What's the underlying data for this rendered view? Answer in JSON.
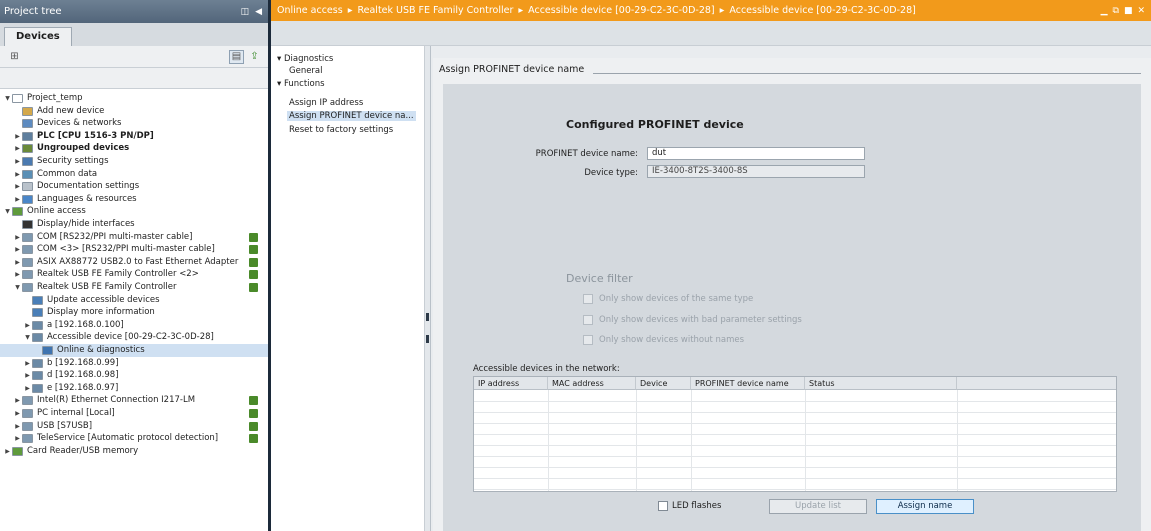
{
  "project_tree": {
    "title": "Project tree",
    "tab": "Devices",
    "items": [
      {
        "label": "Project_temp",
        "level": 0,
        "toggle": "▼",
        "icon": "#ffffff",
        "bold": false
      },
      {
        "label": "Add new device",
        "level": 1,
        "toggle": "",
        "icon": "#d4a84a",
        "bold": false
      },
      {
        "label": "Devices & networks",
        "level": 1,
        "toggle": "",
        "icon": "#5d8bc0",
        "bold": false
      },
      {
        "label": "PLC [CPU 1516-3 PN/DP]",
        "level": 1,
        "toggle": "▶",
        "icon": "#5f7f9e",
        "bold": true
      },
      {
        "label": "Ungrouped devices",
        "level": 1,
        "toggle": "▶",
        "icon": "#6a8a3a",
        "bold": true
      },
      {
        "label": "Security settings",
        "level": 1,
        "toggle": "▶",
        "icon": "#4b7ab0",
        "bold": false
      },
      {
        "label": "Common data",
        "level": 1,
        "toggle": "▶",
        "icon": "#5a8fb5",
        "bold": false
      },
      {
        "label": "Documentation settings",
        "level": 1,
        "toggle": "▶",
        "icon": "#b9c2cb",
        "bold": false
      },
      {
        "label": "Languages & resources",
        "level": 1,
        "toggle": "▶",
        "icon": "#4a86c8",
        "bold": false
      },
      {
        "label": "Online access",
        "level": 0,
        "toggle": "▼",
        "icon": "#5f9b3c",
        "bold": false
      },
      {
        "label": "Display/hide interfaces",
        "level": 1,
        "toggle": "",
        "icon": "#333333",
        "bold": false
      },
      {
        "label": "COM [RS232/PPI multi-master cable]",
        "level": 1,
        "toggle": "▶",
        "icon": "#7f99b0",
        "bold": false,
        "badge": true
      },
      {
        "label": "COM <3> [RS232/PPI multi-master cable]",
        "level": 1,
        "toggle": "▶",
        "icon": "#7f99b0",
        "bold": false,
        "badge": true
      },
      {
        "label": "ASIX AX88772 USB2.0 to Fast Ethernet Adapter",
        "level": 1,
        "toggle": "▶",
        "icon": "#7f99b0",
        "bold": false,
        "badge": true
      },
      {
        "label": "Realtek USB FE Family Controller <2>",
        "level": 1,
        "toggle": "▶",
        "icon": "#7f99b0",
        "bold": false,
        "badge": true
      },
      {
        "label": "Realtek USB FE Family Controller",
        "level": 1,
        "toggle": "▼",
        "icon": "#7f99b0",
        "bold": false,
        "badge": true
      },
      {
        "label": "Update accessible devices",
        "level": 2,
        "toggle": "",
        "icon": "#4a7fb8",
        "bold": false
      },
      {
        "label": "Display more information",
        "level": 2,
        "toggle": "",
        "icon": "#4a7fb8",
        "bold": false
      },
      {
        "label": "a [192.168.0.100]",
        "level": 2,
        "toggle": "▶",
        "icon": "#6b8aa6",
        "bold": false
      },
      {
        "label": "Accessible device [00-29-C2-3C-0D-28]",
        "level": 2,
        "toggle": "▼",
        "icon": "#6b8aa6",
        "bold": false
      },
      {
        "label": "Online & diagnostics",
        "level": 3,
        "toggle": "",
        "icon": "#3f74b0",
        "bold": false,
        "selected": true
      },
      {
        "label": "b [192.168.0.99]",
        "level": 2,
        "toggle": "▶",
        "icon": "#6b8aa6",
        "bold": false
      },
      {
        "label": "d [192.168.0.98]",
        "level": 2,
        "toggle": "▶",
        "icon": "#6b8aa6",
        "bold": false
      },
      {
        "label": "e [192.168.0.97]",
        "level": 2,
        "toggle": "▶",
        "icon": "#6b8aa6",
        "bold": false
      },
      {
        "label": "Intel(R) Ethernet Connection I217-LM",
        "level": 1,
        "toggle": "▶",
        "icon": "#7f99b0",
        "bold": false,
        "badge": true
      },
      {
        "label": "PC internal [Local]",
        "level": 1,
        "toggle": "▶",
        "icon": "#7f99b0",
        "bold": false,
        "badge": true
      },
      {
        "label": "USB [S7USB]",
        "level": 1,
        "toggle": "▶",
        "icon": "#7f99b0",
        "bold": false,
        "badge": true
      },
      {
        "label": "TeleService [Automatic protocol detection]",
        "level": 1,
        "toggle": "▶",
        "icon": "#7f99b0",
        "bold": false,
        "badge": true
      },
      {
        "label": "Card Reader/USB memory",
        "level": 0,
        "toggle": "▶",
        "icon": "#5f9b3c",
        "bold": false
      }
    ]
  },
  "breadcrumb": {
    "items": [
      "Online access",
      "Realtek USB FE Family Controller",
      "Accessible device [00-29-C2-3C-0D-28]",
      "Accessible device [00-29-C2-3C-0D-28]"
    ],
    "separator": "▸"
  },
  "nav": {
    "diagnostics": "Diagnostics",
    "general": "General",
    "functions": "Functions",
    "assign_ip": "Assign IP address",
    "assign_name": "Assign PROFINET device na...",
    "reset": "Reset to factory settings"
  },
  "panel": {
    "heading": "Assign PROFINET device name",
    "configured_title": "Configured PROFINET device",
    "device_name_label": "PROFINET device name:",
    "device_name_value": "dut",
    "device_type_label": "Device type:",
    "device_type_value": "IE-3400-8T2S-3400-8S",
    "filter_title": "Device filter",
    "filter_same_type": "Only show devices of the same type",
    "filter_bad_params": "Only show devices with bad parameter settings",
    "filter_no_names": "Only show devices without names",
    "accessible_label": "Accessible devices in the network:",
    "columns": [
      "IP address",
      "MAC address",
      "Device",
      "PROFINET device name",
      "Status"
    ],
    "led_label": "LED flashes",
    "update_list": "Update list",
    "assign_name": "Assign name"
  },
  "colors": {
    "accent": "#f29a1b",
    "title_bar": "#52657a",
    "primary_button": "#dff0ff"
  }
}
